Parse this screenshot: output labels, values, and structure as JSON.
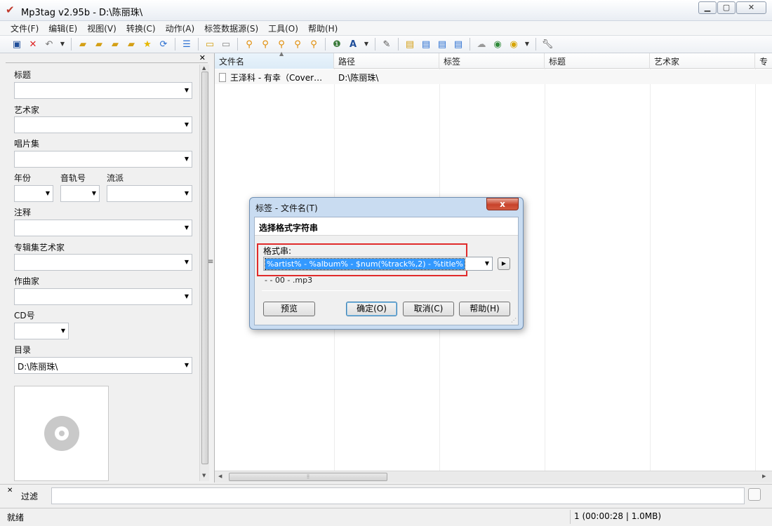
{
  "window": {
    "title": "Mp3tag v2.95b  -  D:\\陈丽珠\\",
    "controls": [
      "minimize",
      "maximize",
      "close"
    ]
  },
  "menu": [
    "文件(F)",
    "编辑(E)",
    "视图(V)",
    "转换(C)",
    "动作(A)",
    "标签数据源(S)",
    "工具(O)",
    "帮助(H)"
  ],
  "toolbar": [
    "save-icon",
    "remove-tag-icon",
    "undo-icon",
    "dropdown-arrow",
    "sep",
    "change-dir-icon",
    "add-dir-icon",
    "folder-icon",
    "folder-open-icon",
    "favorite-star-icon",
    "refresh-icon",
    "sep",
    "list-icon",
    "sep",
    "export-icon",
    "print-icon",
    "sep",
    "tag-to-filename-icon",
    "filename-to-tag-icon",
    "tag-to-tag-icon",
    "text-to-tag-icon",
    "tag-to-text-icon",
    "sep",
    "autonumber-icon",
    "case-convert-icon",
    "dropdown-arrow",
    "sep",
    "edit-tag-icon",
    "sep",
    "playlist-icon",
    "sel-icon",
    "sel2-icon",
    "sort-icon",
    "sep",
    "web-source-icon",
    "freedb-icon",
    "web-icon",
    "dropdown-arrow",
    "sep",
    "options-wrench-icon"
  ],
  "tag_panel": {
    "fields": {
      "title": {
        "label": "标题",
        "value": ""
      },
      "artist": {
        "label": "艺术家",
        "value": ""
      },
      "album": {
        "label": "唱片集",
        "value": ""
      },
      "year": {
        "label": "年份",
        "value": ""
      },
      "track": {
        "label": "音轨号",
        "value": ""
      },
      "genre": {
        "label": "流派",
        "value": ""
      },
      "comment": {
        "label": "注释",
        "value": ""
      },
      "album_artist": {
        "label": "专辑集艺术家",
        "value": ""
      },
      "composer": {
        "label": "作曲家",
        "value": ""
      },
      "disc": {
        "label": "CD号",
        "value": ""
      },
      "directory": {
        "label": "目录",
        "value": "D:\\陈丽珠\\"
      }
    }
  },
  "file_list": {
    "columns": [
      "文件名",
      "路径",
      "标签",
      "标题",
      "艺术家",
      "专"
    ],
    "rows": [
      {
        "filename": "王泽科 - 有幸（Cover…",
        "path": "D:\\陈丽珠\\",
        "tag": "",
        "title": "",
        "artist": ""
      }
    ]
  },
  "filter": {
    "label": "过滤",
    "value": ""
  },
  "status": {
    "left": "就绪",
    "right": "1 (00:00:28 | 1.0MB)"
  },
  "dialog": {
    "title": "标签 - 文件名(T)",
    "heading": "选择格式字符串",
    "format_label": "格式串:",
    "format_value": "%artist% - %album% - $num(%track%,2) - %title%",
    "preview": " -  - 00 - .mp3",
    "buttons": {
      "preview": "预览",
      "ok": "确定(O)",
      "cancel": "取消(C)",
      "help": "帮助(H)"
    },
    "close_label": "x"
  }
}
